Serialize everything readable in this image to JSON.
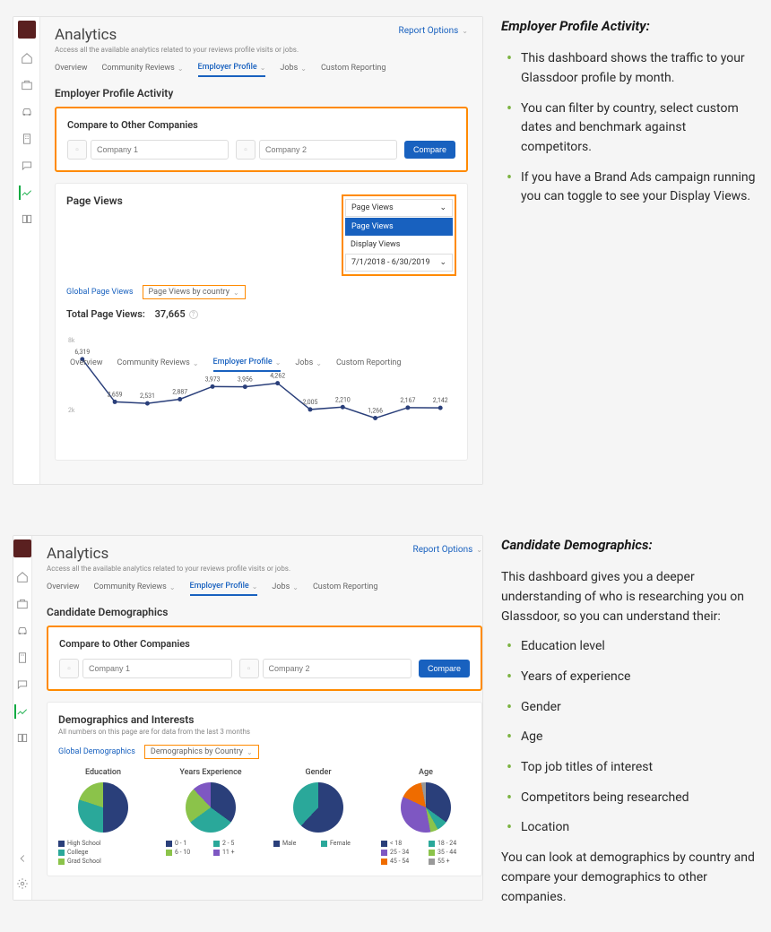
{
  "section1": {
    "heading_right": "Employer Profile Activity:",
    "bullets": [
      "This dashboard shows the traffic to your Glassdoor profile by month.",
      "You can filter by country, select custom dates and benchmark against competitors.",
      "If you have a Brand Ads campaign running you can toggle to see your Display Views."
    ],
    "analytics_title": "Analytics",
    "subtitle": "Access all the available analytics related to your reviews profile visits or jobs.",
    "report_options": "Report Options",
    "tabs": {
      "overview": "Overview",
      "community": "Community Reviews",
      "employer": "Employer Profile",
      "jobs": "Jobs",
      "custom": "Custom Reporting"
    },
    "section_title": "Employer Profile Activity",
    "compare_title": "Compare to Other Companies",
    "company1_ph": "Company 1",
    "company2_ph": "Company 2",
    "compare_btn": "Compare",
    "page_views_title": "Page Views",
    "dd_page_views": "Page Views",
    "dd_display_views": "Display Views",
    "dd_date": "7/1/2018 - 6/30/2019",
    "sub_global": "Global Page Views",
    "sub_country": "Page Views by country",
    "total_label": "Total Page Views:",
    "total_value": "37,665"
  },
  "section2": {
    "heading_right": "Candidate Demographics:",
    "intro": "This dashboard gives you a deeper understanding of who is researching you on Glassdoor, so you can understand their:",
    "bullets": [
      "Education level",
      "Years of experience",
      "Gender",
      "Age",
      "Top job titles of interest",
      "Competitors being researched",
      "Location"
    ],
    "outro": "You can look at demographics by country and compare your demographics to other companies.",
    "section_title": "Candidate Demographics",
    "demo_title": "Demographics and Interests",
    "demo_sub": "All numbers on this page are for data from the last 3 months",
    "sub_global_demo": "Global Demographics",
    "sub_country_demo": "Demographics by Country",
    "pies": {
      "education": {
        "title": "Education",
        "legend": [
          "High School",
          "College",
          "Grad School"
        ]
      },
      "years": {
        "title": "Years Experience",
        "legend": [
          "0 - 1",
          "2 - 5",
          "6 - 10",
          "11 +"
        ]
      },
      "gender": {
        "title": "Gender",
        "legend": [
          "Male",
          "Female"
        ]
      },
      "age": {
        "title": "Age",
        "legend": [
          "< 18",
          "18 - 24",
          "25 - 34",
          "35 - 44",
          "45 - 54",
          "55 +"
        ]
      }
    }
  },
  "chart_data": {
    "type": "line",
    "x": [
      1,
      2,
      3,
      4,
      5,
      6,
      7,
      8,
      9,
      10,
      11,
      12
    ],
    "values": [
      6319,
      2659,
      2531,
      2887,
      3973,
      3956,
      4262,
      2005,
      2210,
      1266,
      2167,
      2142
    ],
    "ylim": [
      0,
      8000
    ],
    "yticks": [
      2000,
      8000
    ],
    "ytick_labels": [
      "2k",
      "8k"
    ]
  },
  "colors": {
    "navy": "#2a3f7a",
    "teal": "#2aa89a",
    "lime": "#8bc34a",
    "purple": "#7e57c2",
    "orange": "#ef6c00",
    "green": "#0caa41"
  }
}
